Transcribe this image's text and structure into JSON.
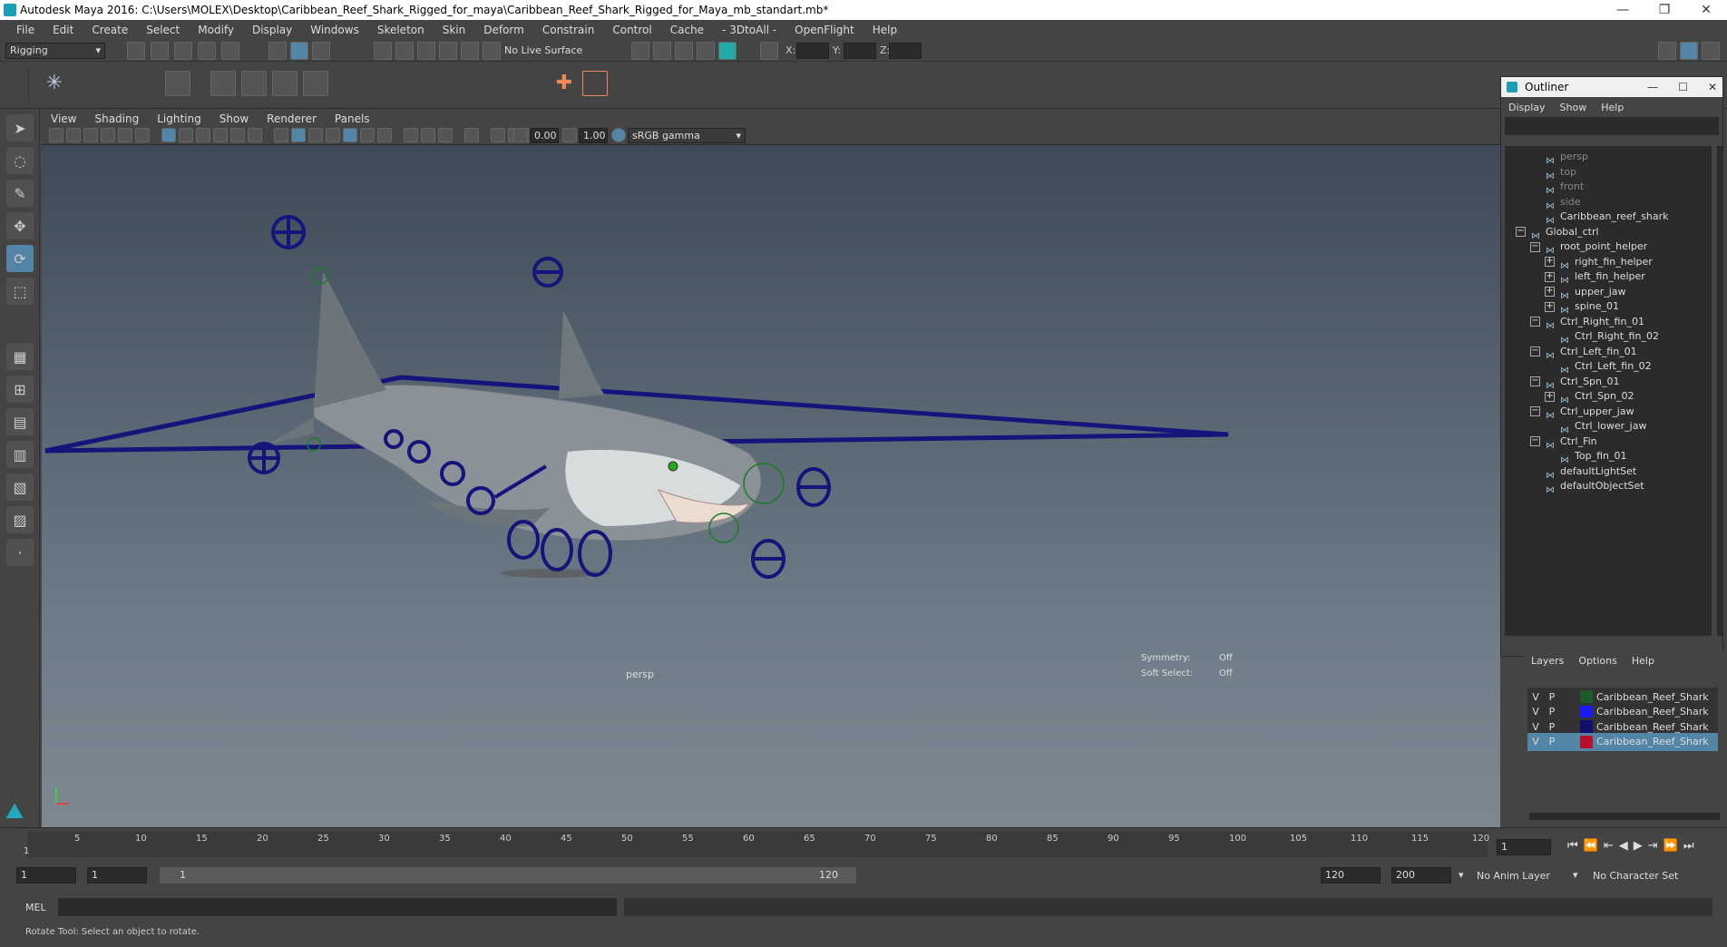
{
  "window": {
    "title": "Autodesk Maya 2016: C:\\Users\\MOLEX\\Desktop\\Caribbean_Reef_Shark_Rigged_for_maya\\Caribbean_Reef_Shark_Rigged_for_Maya_mb_standart.mb*"
  },
  "menubar": [
    "File",
    "Edit",
    "Create",
    "Select",
    "Modify",
    "Display",
    "Windows",
    "Skeleton",
    "Skin",
    "Deform",
    "Constrain",
    "Control",
    "Cache",
    "- 3DtoAll -",
    "OpenFlight",
    "Help"
  ],
  "statusline": {
    "mode": "Rigging",
    "live_surface": "No Live Surface",
    "x_label": "X:",
    "y_label": "Y:",
    "z_label": "Z:"
  },
  "panel": {
    "menu": [
      "View",
      "Shading",
      "Lighting",
      "Show",
      "Renderer",
      "Panels"
    ],
    "exposure": "0.00",
    "gamma": "1.00",
    "colorspace": "sRGB gamma",
    "camera_label": "persp",
    "symmetry_label": "Symmetry:",
    "symmetry_value": "Off",
    "soft_select_label": "Soft Select:",
    "soft_select_value": "Off"
  },
  "outliner": {
    "title": "Outliner",
    "menu": [
      "Display",
      "Show",
      "Help"
    ],
    "items": [
      {
        "label": "persp",
        "dim": true
      },
      {
        "label": "top",
        "dim": true
      },
      {
        "label": "front",
        "dim": true
      },
      {
        "label": "side",
        "dim": true
      },
      {
        "label": "Caribbean_reef_shark"
      },
      {
        "label": "Global_ctrl",
        "toggle": "−"
      },
      {
        "label": "root_point_helper",
        "toggle": "−"
      },
      {
        "label": "right_fin_helper",
        "toggle": "+"
      },
      {
        "label": "left_fin_helper",
        "toggle": "+"
      },
      {
        "label": "upper_jaw",
        "toggle": "+"
      },
      {
        "label": "spine_01",
        "toggle": "+"
      },
      {
        "label": "Ctrl_Right_fin_01",
        "toggle": "−"
      },
      {
        "label": "Ctrl_Right_fin_02"
      },
      {
        "label": "Ctrl_Left_fin_01",
        "toggle": "−"
      },
      {
        "label": "Ctrl_Left_fin_02"
      },
      {
        "label": "Ctrl_Spn_01",
        "toggle": "−"
      },
      {
        "label": "Ctrl_Spn_02",
        "toggle": "+"
      },
      {
        "label": "Ctrl_upper_jaw",
        "toggle": "−"
      },
      {
        "label": "Ctrl_lower_jaw"
      },
      {
        "label": "Ctrl_Fin",
        "toggle": "−"
      },
      {
        "label": "Top_fin_01"
      },
      {
        "label": "defaultLightSet"
      },
      {
        "label": "defaultObjectSet"
      }
    ]
  },
  "layers": {
    "menu": [
      "Layers",
      "Options",
      "Help"
    ],
    "rows": [
      {
        "v": "V",
        "p": "P",
        "color": "#1f5a2a",
        "name": "Caribbean_Reef_Shark"
      },
      {
        "v": "V",
        "p": "P",
        "color": "#1a1aff",
        "name": "Caribbean_Reef_Shark"
      },
      {
        "v": "V",
        "p": "P",
        "color": "#10106a",
        "name": "Caribbean_Reef_Shark"
      },
      {
        "v": "V",
        "p": "P",
        "color": "#b8102a",
        "name": "Caribbean_Reef_Shark",
        "selected": true
      }
    ]
  },
  "timeline": {
    "ticks": [
      "5",
      "10",
      "15",
      "20",
      "25",
      "30",
      "35",
      "40",
      "45",
      "50",
      "55",
      "60",
      "65",
      "70",
      "75",
      "80",
      "85",
      "90",
      "95",
      "100",
      "105",
      "110",
      "115",
      "120"
    ],
    "start_marker": "1",
    "current_frame": "1"
  },
  "range": {
    "start": "1",
    "anim_start": "1",
    "slider_start": "1",
    "slider_end": "120",
    "anim_end": "120",
    "end": "200",
    "anim_layer": "No Anim Layer",
    "character_set": "No Character Set"
  },
  "cmdline": {
    "label": "MEL"
  },
  "helpline": {
    "text": "Rotate Tool: Select an object to rotate."
  }
}
